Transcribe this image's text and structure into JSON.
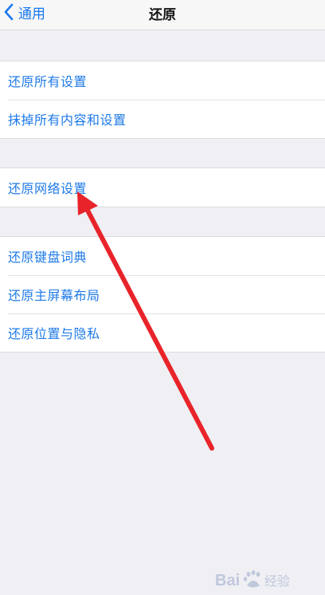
{
  "nav": {
    "back_label": "通用",
    "title": "还原"
  },
  "groups": [
    {
      "items": [
        {
          "label": "还原所有设置"
        },
        {
          "label": "抹掉所有内容和设置"
        }
      ]
    },
    {
      "items": [
        {
          "label": "还原网络设置"
        }
      ]
    },
    {
      "items": [
        {
          "label": "还原键盘词典"
        },
        {
          "label": "还原主屏幕布局"
        },
        {
          "label": "还原位置与隐私"
        }
      ]
    }
  ],
  "annotation": {
    "arrow_color": "#e8242a",
    "target": "还原网络设置"
  },
  "watermark": {
    "text": "Baidu 经验",
    "icon": "baidu-paw-icon"
  },
  "colors": {
    "background": "#efeff4",
    "accent": "#1f7ae8"
  }
}
